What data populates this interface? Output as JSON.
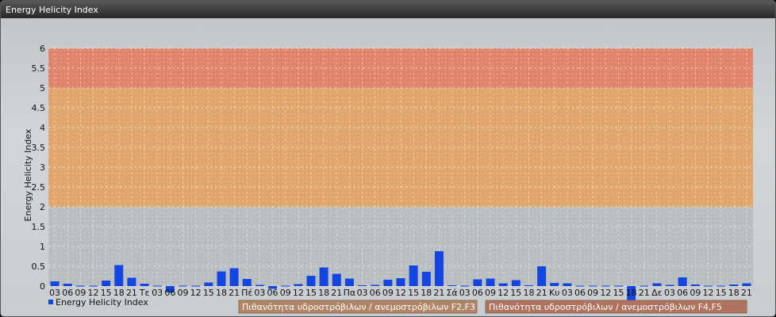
{
  "window": {
    "title": "Energy Helicity Index"
  },
  "chart_data": {
    "type": "bar",
    "title": "",
    "xlabel": "",
    "ylabel": "Energy Helicity Index",
    "ylim": [
      0,
      6
    ],
    "yticks": [
      "0",
      "0.5",
      "1",
      "1.5",
      "2",
      "2.5",
      "3",
      "3.5",
      "4",
      "4.5",
      "5",
      "5.5",
      "6"
    ],
    "grid": true,
    "legend_position": "bottom-left",
    "bar_color": "#1346e0",
    "bands": [
      {
        "from": 0,
        "to": 2,
        "color": "#b8bdc0",
        "label": ""
      },
      {
        "from": 2,
        "to": 5,
        "color": "#e0a56b",
        "label": "Πιθανότητα υδροστρόβιλων / ανεμοστρόβιλων F2,F3",
        "legend_color": "#b08568"
      },
      {
        "from": 5,
        "to": 6,
        "color": "#e0836b",
        "label": "Πιθανότητα υδροστρόβιλων / ανεμοστρόβιλων F4,F5",
        "legend_color": "#b07360"
      }
    ],
    "categories": [
      "03",
      "06",
      "09",
      "12",
      "15",
      "18",
      "21",
      "Τε",
      "03",
      "06",
      "09",
      "12",
      "15",
      "18",
      "21",
      "Πέ",
      "03",
      "06",
      "09",
      "12",
      "15",
      "18",
      "21",
      "Πα",
      "03",
      "06",
      "09",
      "12",
      "15",
      "18",
      "21",
      "Σά",
      "03",
      "06",
      "09",
      "12",
      "15",
      "18",
      "21",
      "Κυ",
      "03",
      "06",
      "09",
      "12",
      "15",
      "18",
      "21",
      "Δε",
      "03",
      "06",
      "09",
      "12",
      "15",
      "18",
      "21"
    ],
    "series": [
      {
        "name": "Energy Helicity Index",
        "values": [
          0.12,
          0.06,
          0.01,
          0.01,
          0.14,
          0.53,
          0.21,
          0.06,
          0.01,
          -0.16,
          0.01,
          0.01,
          0.09,
          0.37,
          0.45,
          0.18,
          0.03,
          -0.07,
          0.01,
          0.05,
          0.26,
          0.47,
          0.31,
          0.19,
          0.02,
          0.03,
          0.16,
          0.2,
          0.52,
          0.36,
          0.88,
          0.02,
          0.01,
          0.17,
          0.19,
          0.07,
          0.15,
          0.02,
          0.5,
          0.08,
          0.07,
          0.01,
          0.01,
          0.01,
          0.01,
          -0.36,
          0.01,
          0.07,
          0.03,
          0.22,
          0.04,
          0.01,
          0.01,
          0.04,
          0.07
        ]
      }
    ]
  }
}
